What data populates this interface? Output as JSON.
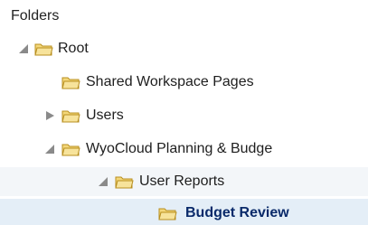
{
  "header": {
    "title": "Folders"
  },
  "tree": {
    "root": {
      "label": "Root",
      "state": "expanded"
    },
    "shared": {
      "label": "Shared Workspace Pages"
    },
    "users": {
      "label": "Users",
      "state": "collapsed"
    },
    "wyocloud": {
      "label": "WyoCloud Planning & Budge",
      "state": "expanded"
    },
    "user_reports": {
      "label": "User Reports",
      "state": "expanded"
    },
    "budget_review": {
      "label": "Budget Review",
      "selected": true
    }
  },
  "colors": {
    "folder_fill": "#f3d77a",
    "folder_stroke": "#b88f1f",
    "arrow": "#8a8a8a",
    "selected_row": "#e4eef7"
  },
  "icons": {
    "folder": "folder-icon",
    "expanded": "triangle-expanded-icon",
    "collapsed": "triangle-collapsed-icon"
  }
}
